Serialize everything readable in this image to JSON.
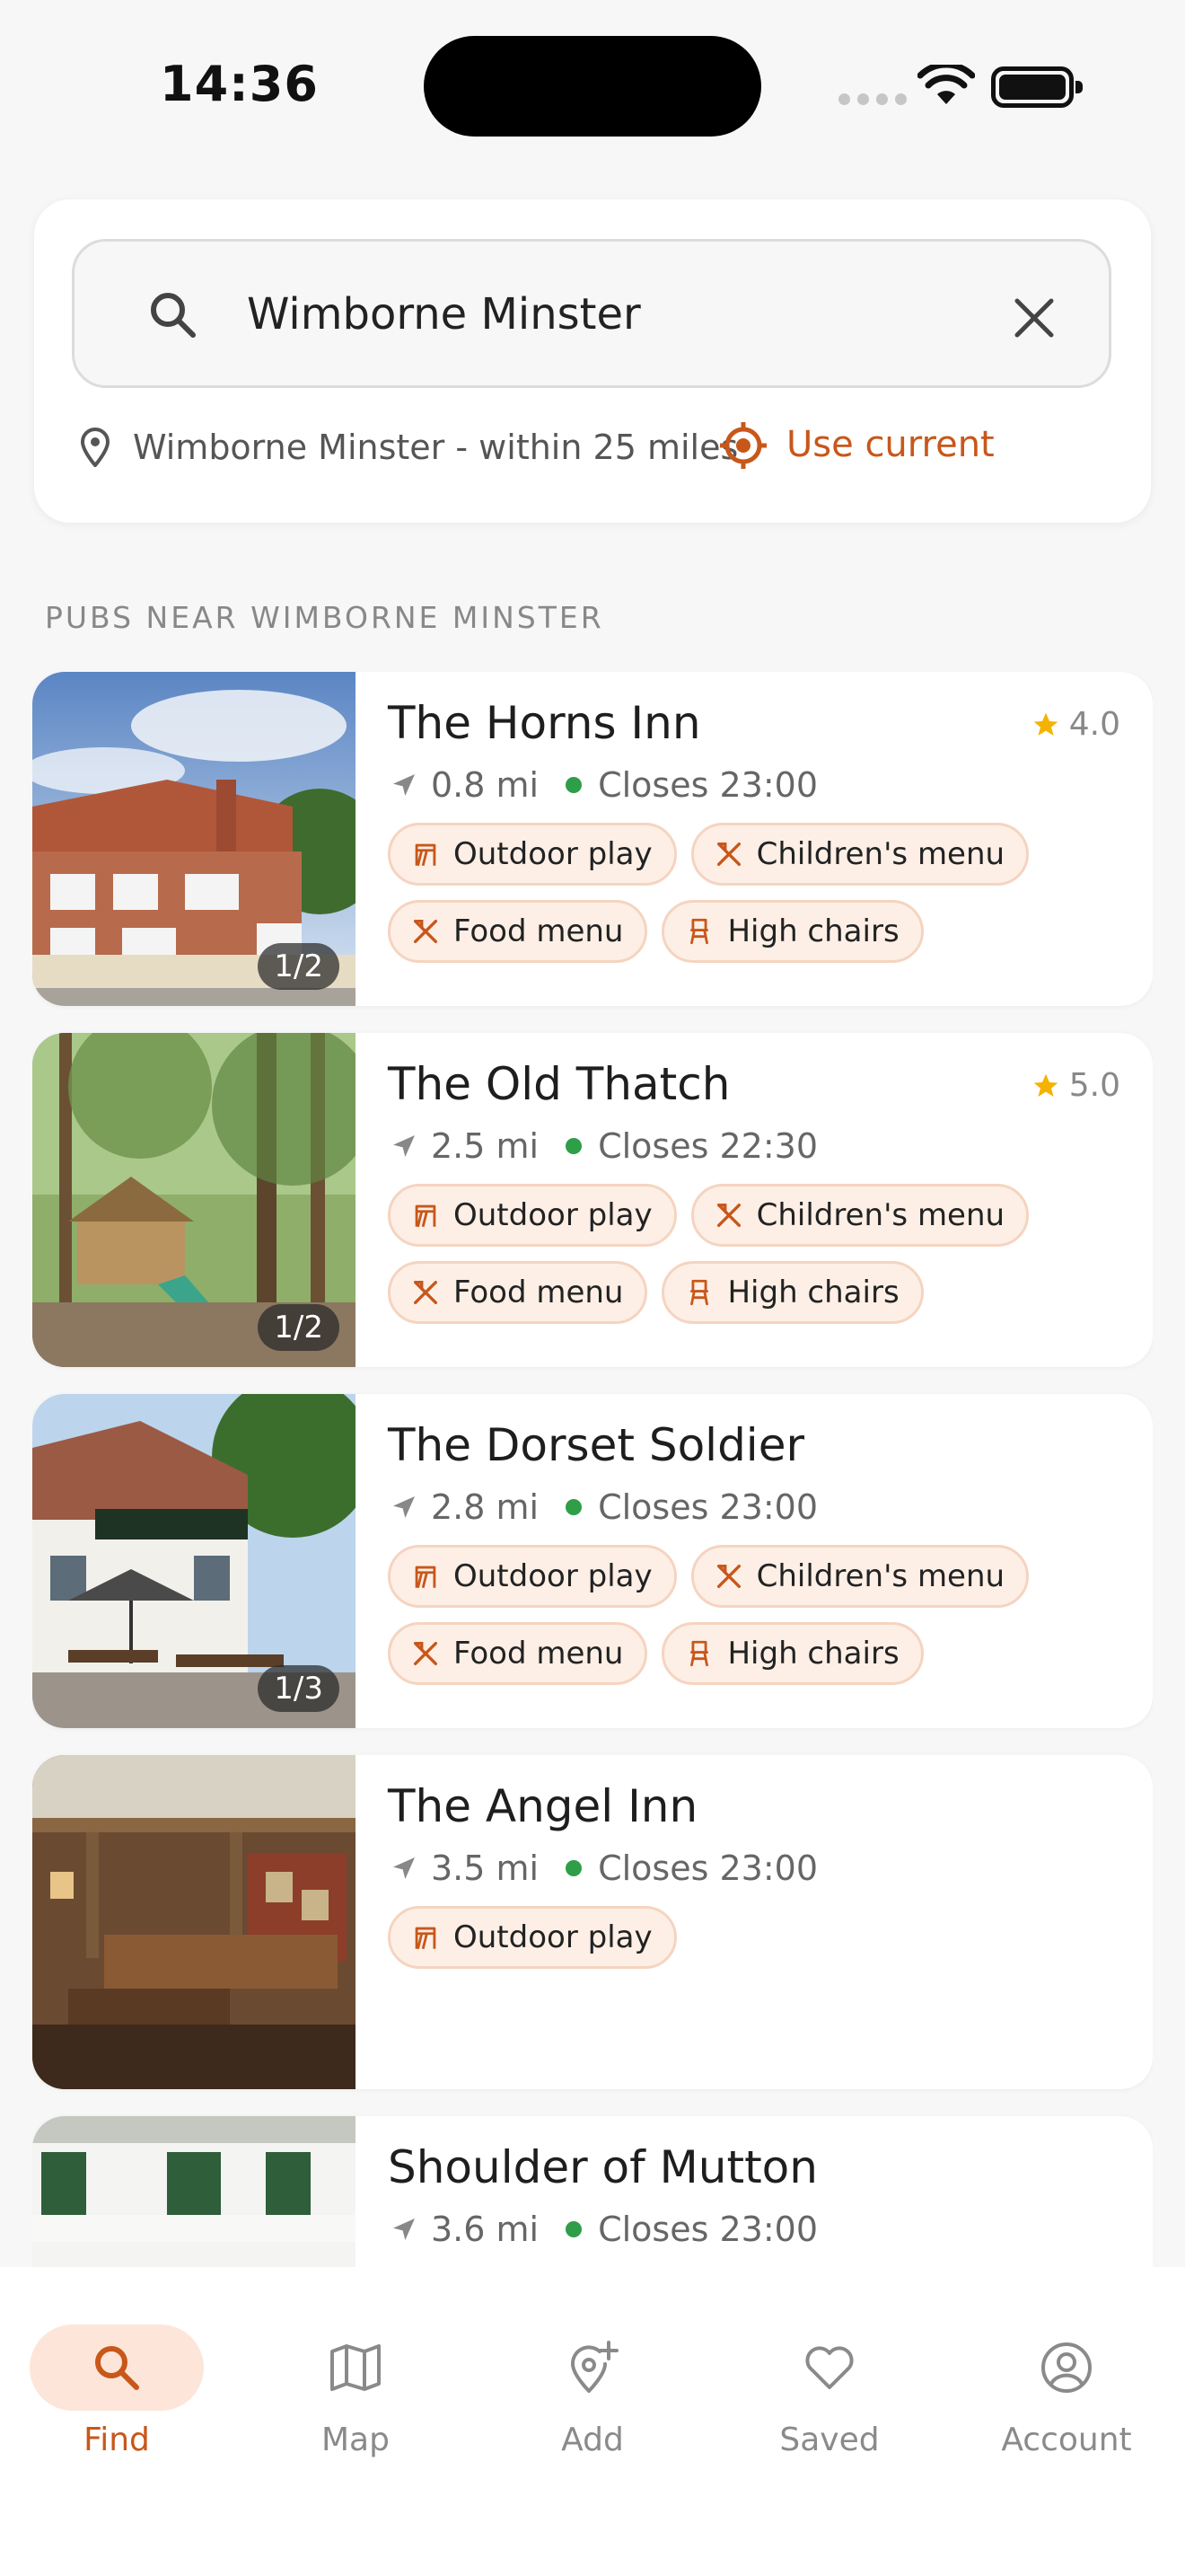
{
  "status_bar": {
    "time": "14:36"
  },
  "search": {
    "value": "Wimborne Minster",
    "location_text": "Wimborne Minster - within 25 miles",
    "use_current_label": "Use current"
  },
  "section_title": "PUBS NEAR WIMBORNE MINSTER",
  "pubs": [
    {
      "name": "The Horns Inn",
      "rating": "4.0",
      "distance": "0.8 mi",
      "closes": "Closes 23:00",
      "photo_counter": "1/2",
      "tags": [
        "Outdoor play",
        "Children's menu",
        "Food menu",
        "High chairs"
      ]
    },
    {
      "name": "The Old Thatch",
      "rating": "5.0",
      "distance": "2.5 mi",
      "closes": "Closes 22:30",
      "photo_counter": "1/2",
      "tags": [
        "Outdoor play",
        "Children's menu",
        "Food menu",
        "High chairs"
      ]
    },
    {
      "name": "The Dorset Soldier",
      "distance": "2.8 mi",
      "closes": "Closes 23:00",
      "photo_counter": "1/3",
      "tags": [
        "Outdoor play",
        "Children's menu",
        "Food menu",
        "High chairs"
      ]
    },
    {
      "name": "The Angel Inn",
      "distance": "3.5 mi",
      "closes": "Closes 23:00",
      "tags": [
        "Outdoor play"
      ]
    },
    {
      "name": "Shoulder of Mutton",
      "distance": "3.6 mi",
      "closes": "Closes 23:00",
      "tags": []
    }
  ],
  "tab_bar": {
    "tabs": [
      {
        "label": "Find",
        "icon": "search-icon",
        "active": true
      },
      {
        "label": "Map",
        "icon": "map-icon",
        "active": false
      },
      {
        "label": "Add",
        "icon": "add-location-icon",
        "active": false
      },
      {
        "label": "Saved",
        "icon": "heart-icon",
        "active": false
      },
      {
        "label": "Account",
        "icon": "account-icon",
        "active": false
      }
    ]
  },
  "colors": {
    "accent": "#c8571a",
    "tag_bg": "#fdefe6",
    "tag_border": "#f5d4c0",
    "open_dot": "#2e9e48",
    "star": "#f5b301"
  }
}
